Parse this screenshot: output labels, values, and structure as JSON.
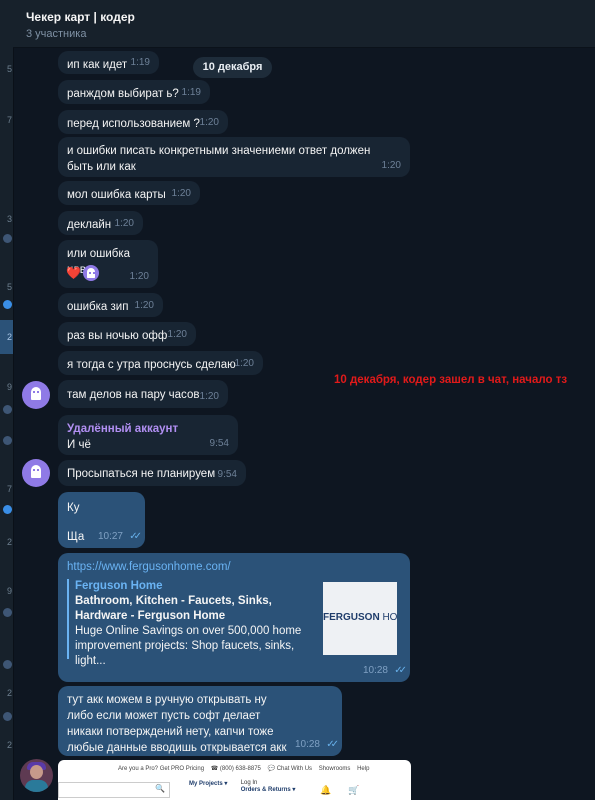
{
  "header": {
    "title": "Чекер карт | кодер",
    "subtitle": "3 участника"
  },
  "date_pill": "10 декабря",
  "left_numbers": [
    "5",
    "7",
    "3",
    "5",
    "2",
    "9",
    "7",
    "2",
    "9",
    "2",
    "2"
  ],
  "messages": [
    {
      "text": "ип как идет",
      "time": "1:19"
    },
    {
      "text": "ранждом выбират ь?",
      "time": "1:19"
    },
    {
      "text": "перед использованием ?",
      "time": "1:20"
    },
    {
      "text": "и ошибки писать конкретными значениеми ответ должен быть или как",
      "time": "1:20"
    },
    {
      "text": "мол ошибка карты",
      "time": "1:20"
    },
    {
      "text": "деклайн",
      "time": "1:20"
    },
    {
      "text": "или ошибка цвв",
      "time": "1:20"
    },
    {
      "text": "ошибка зип",
      "time": "1:20"
    },
    {
      "text": "раз вы ночью офф",
      "time": "1:20"
    },
    {
      "text": "я тогда с утра проснусь сделаю",
      "time": "1:20"
    },
    {
      "text": "там делов на пару часов",
      "time": "1:20"
    },
    {
      "sender": "Удалённый аккаунт",
      "text": "И чё",
      "time": "9:54"
    },
    {
      "text": "Просыпаться не планируем",
      "time": "9:54"
    }
  ],
  "reaction": {
    "emoji": "❤️"
  },
  "annotation": "10 декабря, кодер зашел в чат, начало тз",
  "outgoing": [
    {
      "line1": "Ку",
      "line2": "Ща",
      "time": "10:27",
      "ticks": "✓✓"
    },
    {
      "link": "https://www.fergusonhome.com/",
      "preview": {
        "site": "Ferguson Home",
        "title": "Bathroom, Kitchen - Faucets, Sinks, Hardware - Ferguson Home",
        "description": "Huge Online Savings on over 500,000 home improvement projects: Shop faucets, sinks, light...",
        "image_logo": "FERGUSON",
        "image_logo_suffix": " HOM"
      },
      "time": "10:28",
      "ticks": "✓✓"
    },
    {
      "text": "тут акк можем в ручную открывать ну либо если может пусть софт делает никаки потверждений нету, капчи тоже любые данные вводишь открывается акк",
      "time": "10:28",
      "ticks": "✓✓"
    }
  ],
  "screenshot": {
    "top_text": "Are you a Pro? Get PRO Pricing",
    "pro_badge": "PRO",
    "phone": "☎ (800) 638-8875",
    "chat": "💬 Chat With Us",
    "showrooms": "Showrooms",
    "help": "Help",
    "search_icon": "🔍",
    "my_projects": "My Projects ▾",
    "login": "Log In",
    "orders": "Orders & Returns ▾"
  }
}
